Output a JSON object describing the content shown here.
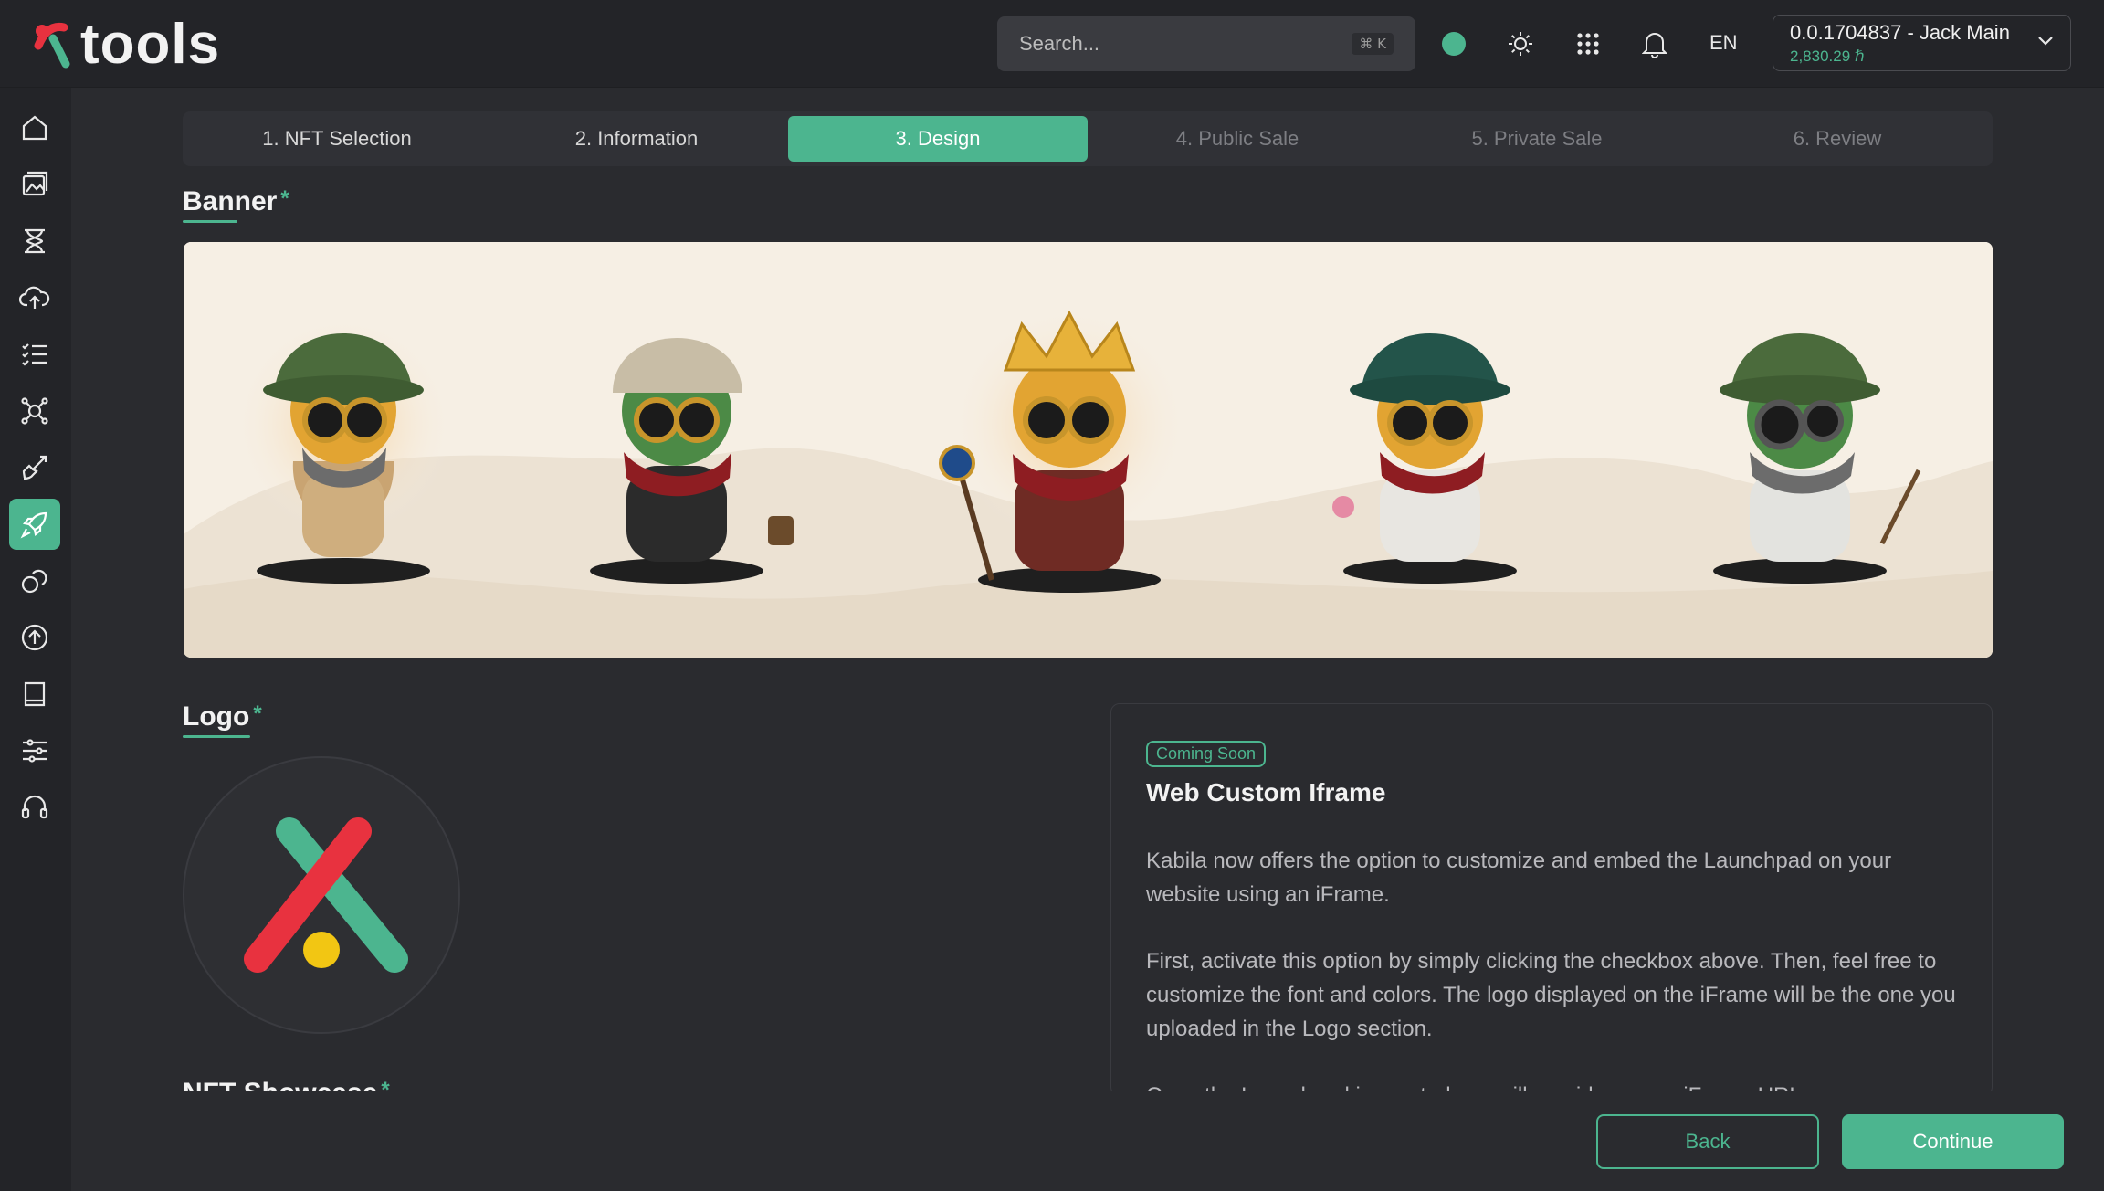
{
  "app": {
    "name": "tools"
  },
  "search": {
    "placeholder": "Search...",
    "shortcut": "⌘ K"
  },
  "header": {
    "language": "EN",
    "account": {
      "id": "0.0.1704837 - Jack Main",
      "balance": "2,830.29 ℏ"
    }
  },
  "sidebar": {
    "items": [
      {
        "icon": "home-icon"
      },
      {
        "icon": "gallery-icon"
      },
      {
        "icon": "hourglass-icon"
      },
      {
        "icon": "cloud-upload-icon"
      },
      {
        "icon": "checklist-icon"
      },
      {
        "icon": "network-icon"
      },
      {
        "icon": "brush-icon"
      },
      {
        "icon": "rocket-icon",
        "active": true
      },
      {
        "icon": "coins-icon"
      },
      {
        "icon": "upload-circle-icon"
      },
      {
        "icon": "book-icon"
      },
      {
        "icon": "sliders-icon"
      },
      {
        "icon": "headset-icon"
      }
    ]
  },
  "stepper": {
    "steps": [
      {
        "label": "1. NFT Selection",
        "state": "done"
      },
      {
        "label": "2. Information",
        "state": "done"
      },
      {
        "label": "3. Design",
        "state": "active"
      },
      {
        "label": "4. Public Sale",
        "state": "todo"
      },
      {
        "label": "5. Private Sale",
        "state": "todo"
      },
      {
        "label": "6. Review",
        "state": "todo"
      }
    ]
  },
  "sections": {
    "banner": {
      "title": "Banner",
      "required": "*"
    },
    "logo": {
      "title": "Logo",
      "required": "*"
    },
    "nft_showcase": {
      "title": "NFT Showcase",
      "required": "*"
    }
  },
  "info_card": {
    "badge": "Coming Soon",
    "title": "Web Custom Iframe",
    "paragraphs": [
      "Kabila now offers the option to customize and embed the Launchpad on your website using an iFrame.",
      "First, activate this option by simply clicking the checkbox above. Then, feel free to customize the font and colors. The logo displayed on the iFrame will be the one you uploaded in the Logo section.",
      "Once the Launchpad is created, we will provide you an iFrame URL."
    ]
  },
  "footer": {
    "back_label": "Back",
    "continue_label": "Continue"
  },
  "colors": {
    "accent": "#4cb58f",
    "background": "#2a2b2f",
    "panel": "#232428"
  }
}
